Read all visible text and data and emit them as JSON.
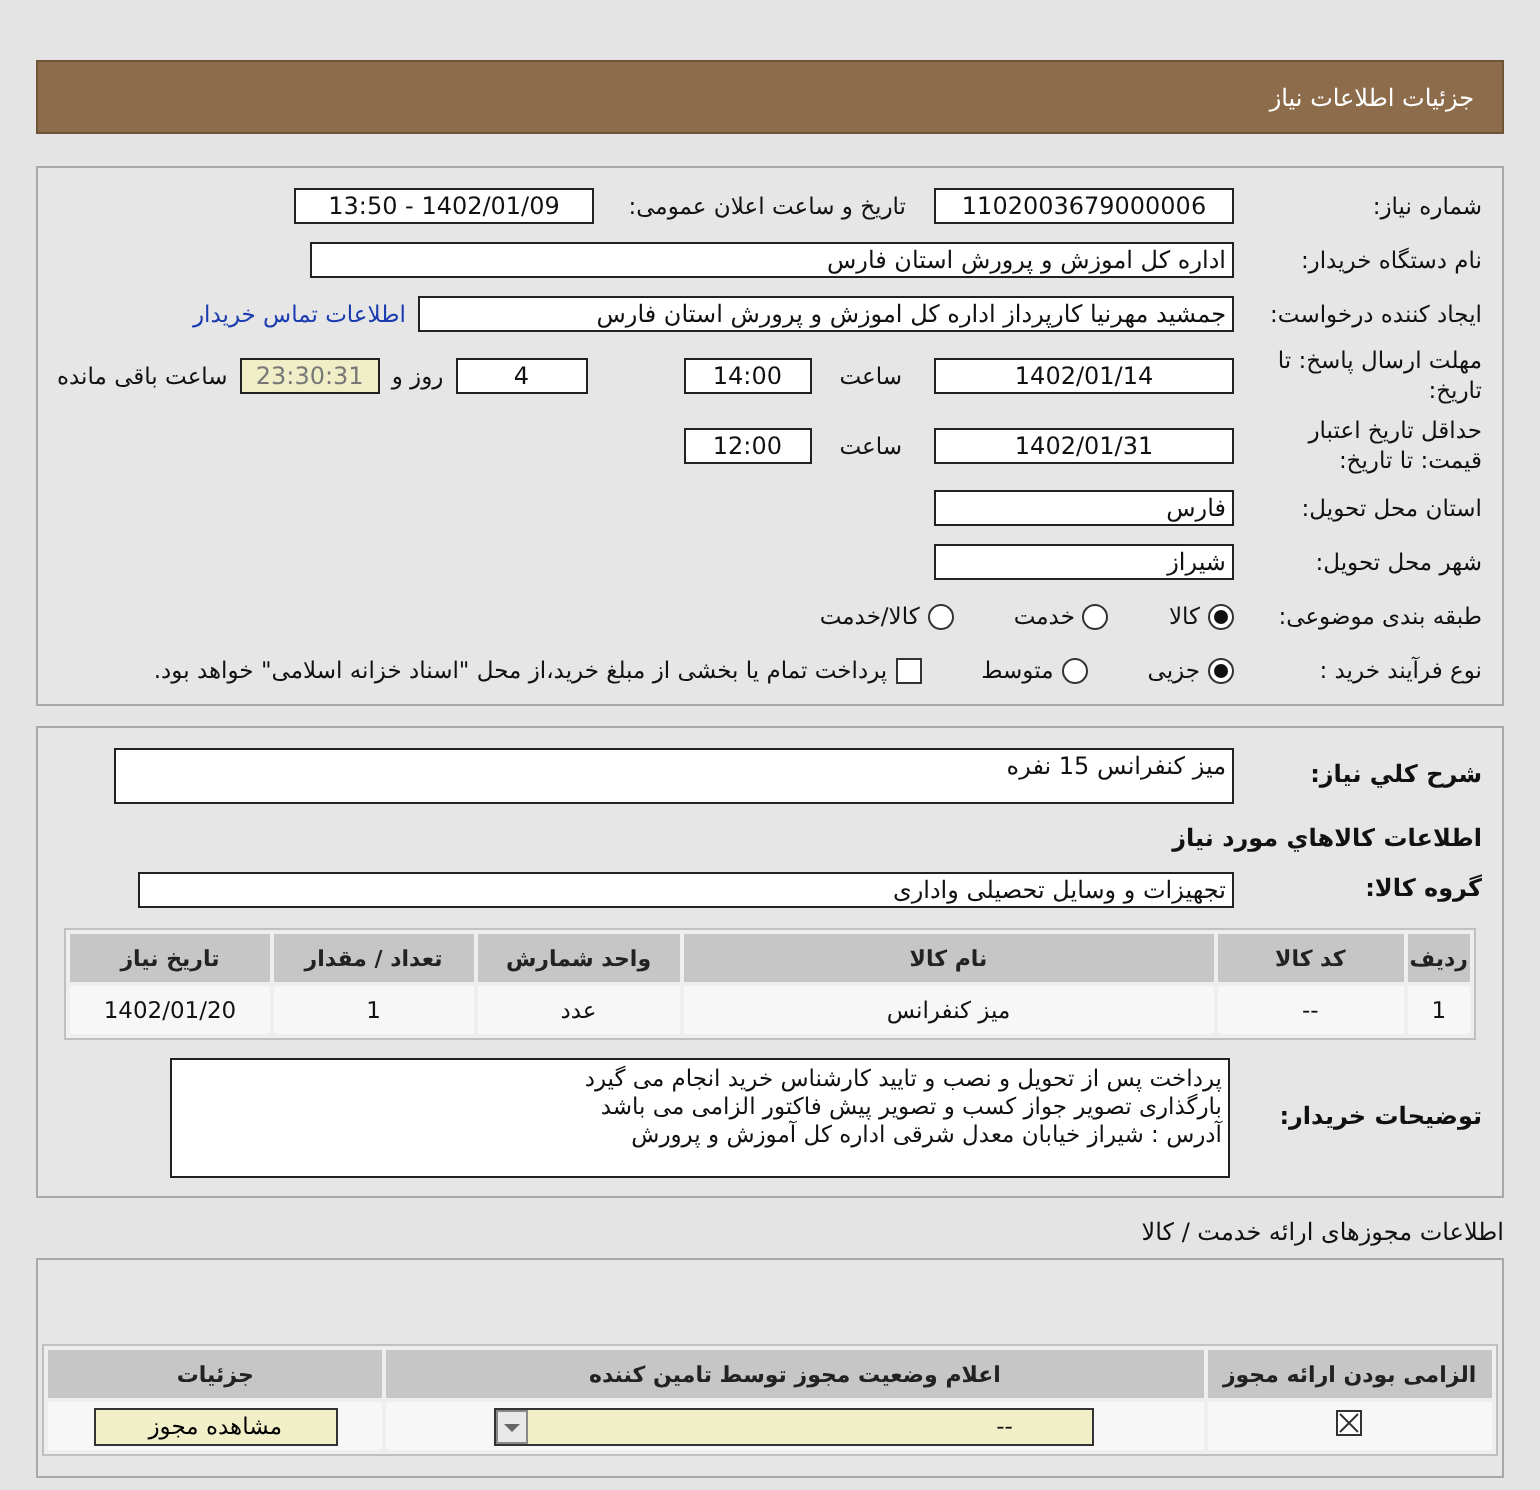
{
  "header": {
    "title": "جزئیات اطلاعات نیاز"
  },
  "summary": {
    "need_number": {
      "label": "شماره نیاز:",
      "value": "1102003679000006"
    },
    "announce": {
      "label": "تاریخ و ساعت اعلان عمومی:",
      "value": "1402/01/09 - 13:50"
    },
    "buyer": {
      "label": "نام دستگاه خریدار:",
      "value": "اداره کل اموزش و پرورش استان فارس"
    },
    "requester": {
      "label": "ایجاد کننده درخواست:",
      "value": "جمشید مهرنیا کارپرداز اداره کل اموزش و پرورش استان فارس"
    },
    "contact_link": "اطلاعات تماس خریدار",
    "deadline": {
      "label": "مهلت ارسال پاسخ: تا تاریخ:",
      "date": "1402/01/14",
      "time_label": "ساعت",
      "time": "14:00",
      "days": "4",
      "days_label": "روز و",
      "remaining": "23:30:31",
      "remaining_label": "ساعت باقی مانده"
    },
    "validity": {
      "label": "حداقل تاریخ اعتبار قیمت: تا تاریخ:",
      "date": "1402/01/31",
      "time_label": "ساعت",
      "time": "12:00"
    },
    "province": {
      "label": "استان محل تحویل:",
      "value": "فارس"
    },
    "city": {
      "label": "شهر محل تحویل:",
      "value": "شیراز"
    },
    "category": {
      "label": "طبقه بندی موضوعی:",
      "options": [
        {
          "label": "کالا",
          "selected": true
        },
        {
          "label": "خدمت",
          "selected": false
        },
        {
          "label": "کالا/خدمت",
          "selected": false
        }
      ]
    },
    "process": {
      "label": "نوع فرآیند خرید :",
      "options": [
        {
          "label": "جزیی",
          "selected": true
        },
        {
          "label": "متوسط",
          "selected": false
        }
      ],
      "prepay": {
        "label": "پرداخت تمام یا بخشی از مبلغ خرید،از محل \"اسناد خزانه اسلامی\" خواهد بود.",
        "checked": false
      }
    }
  },
  "items": {
    "description": {
      "label": "شرح کلي نياز:",
      "value": "میز کنفرانس 15 نفره"
    },
    "title": "اطلاعات کالاهاي مورد نياز",
    "group": {
      "label": "گروه کالا:",
      "value": "تجهیزات و وسایل تحصیلی واداری"
    },
    "table": {
      "columns": [
        "ردیف",
        "کد کالا",
        "نام کالا",
        "واحد شمارش",
        "تعداد / مقدار",
        "تاریخ نیاز"
      ],
      "rows": [
        [
          "1",
          "--",
          "میز کنفرانس",
          "عدد",
          "1",
          "1402/01/20"
        ]
      ]
    },
    "notes": {
      "label": "توضیحات خریدار:",
      "lines": [
        "پرداخت پس از تحویل و نصب و تایید کارشناس خرید انجام می گیرد",
        "بارگذاری تصویر جواز کسب و تصویر پیش فاکتور الزامی می باشد",
        "آدرس : شیراز خیابان معدل شرقی اداره کل آموزش و پرورش"
      ]
    }
  },
  "licenses": {
    "title": "اطلاعات مجوزهای ارائه خدمت / کالا",
    "columns": [
      "الزامی بودن ارائه مجوز",
      "اعلام وضعیت مجوز توسط تامین کننده",
      "جزئیات"
    ],
    "rows": [
      {
        "required": true,
        "status": "--",
        "button": "مشاهده مجوز"
      }
    ]
  }
}
